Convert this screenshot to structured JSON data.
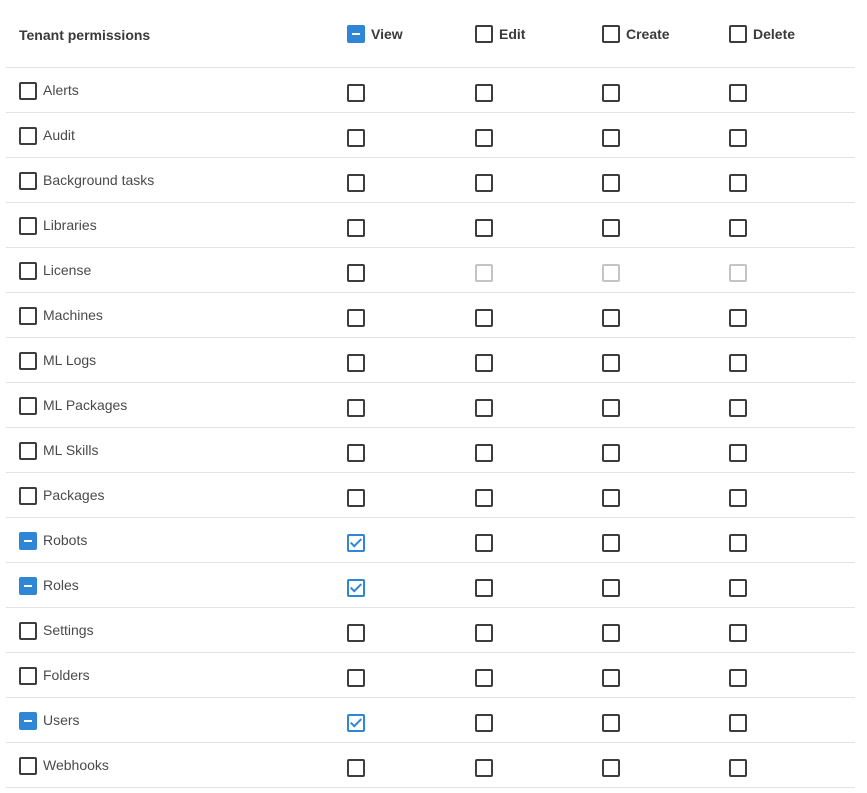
{
  "header": {
    "title": "Tenant permissions",
    "columns": [
      {
        "label": "View",
        "state": "indeterminate"
      },
      {
        "label": "Edit",
        "state": "unchecked"
      },
      {
        "label": "Create",
        "state": "unchecked"
      },
      {
        "label": "Delete",
        "state": "unchecked"
      }
    ]
  },
  "rows": [
    {
      "label": "Alerts",
      "row_state": "unchecked",
      "view": "unchecked",
      "edit": "unchecked",
      "create": "unchecked",
      "delete": "unchecked"
    },
    {
      "label": "Audit",
      "row_state": "unchecked",
      "view": "unchecked",
      "edit": "unchecked",
      "create": "unchecked",
      "delete": "unchecked"
    },
    {
      "label": "Background tasks",
      "row_state": "unchecked",
      "view": "unchecked",
      "edit": "unchecked",
      "create": "unchecked",
      "delete": "unchecked"
    },
    {
      "label": "Libraries",
      "row_state": "unchecked",
      "view": "unchecked",
      "edit": "unchecked",
      "create": "unchecked",
      "delete": "unchecked"
    },
    {
      "label": "License",
      "row_state": "unchecked",
      "view": "unchecked",
      "edit": "disabled",
      "create": "disabled",
      "delete": "disabled"
    },
    {
      "label": "Machines",
      "row_state": "unchecked",
      "view": "unchecked",
      "edit": "unchecked",
      "create": "unchecked",
      "delete": "unchecked"
    },
    {
      "label": "ML Logs",
      "row_state": "unchecked",
      "view": "unchecked",
      "edit": "unchecked",
      "create": "unchecked",
      "delete": "unchecked"
    },
    {
      "label": "ML Packages",
      "row_state": "unchecked",
      "view": "unchecked",
      "edit": "unchecked",
      "create": "unchecked",
      "delete": "unchecked"
    },
    {
      "label": "ML Skills",
      "row_state": "unchecked",
      "view": "unchecked",
      "edit": "unchecked",
      "create": "unchecked",
      "delete": "unchecked"
    },
    {
      "label": "Packages",
      "row_state": "unchecked",
      "view": "unchecked",
      "edit": "unchecked",
      "create": "unchecked",
      "delete": "unchecked"
    },
    {
      "label": "Robots",
      "row_state": "indeterminate",
      "view": "checked",
      "edit": "unchecked",
      "create": "unchecked",
      "delete": "unchecked"
    },
    {
      "label": "Roles",
      "row_state": "indeterminate",
      "view": "checked",
      "edit": "unchecked",
      "create": "unchecked",
      "delete": "unchecked"
    },
    {
      "label": "Settings",
      "row_state": "unchecked",
      "view": "unchecked",
      "edit": "unchecked",
      "create": "unchecked",
      "delete": "unchecked"
    },
    {
      "label": "Folders",
      "row_state": "unchecked",
      "view": "unchecked",
      "edit": "unchecked",
      "create": "unchecked",
      "delete": "unchecked"
    },
    {
      "label": "Users",
      "row_state": "indeterminate",
      "view": "checked",
      "edit": "unchecked",
      "create": "unchecked",
      "delete": "unchecked"
    },
    {
      "label": "Webhooks",
      "row_state": "unchecked",
      "view": "unchecked",
      "edit": "unchecked",
      "create": "unchecked",
      "delete": "unchecked"
    }
  ],
  "colors": {
    "accent": "#2f86d7",
    "border": "#3d3d3d",
    "disabled": "#c4c4c4",
    "divider": "#e3e3e3"
  }
}
